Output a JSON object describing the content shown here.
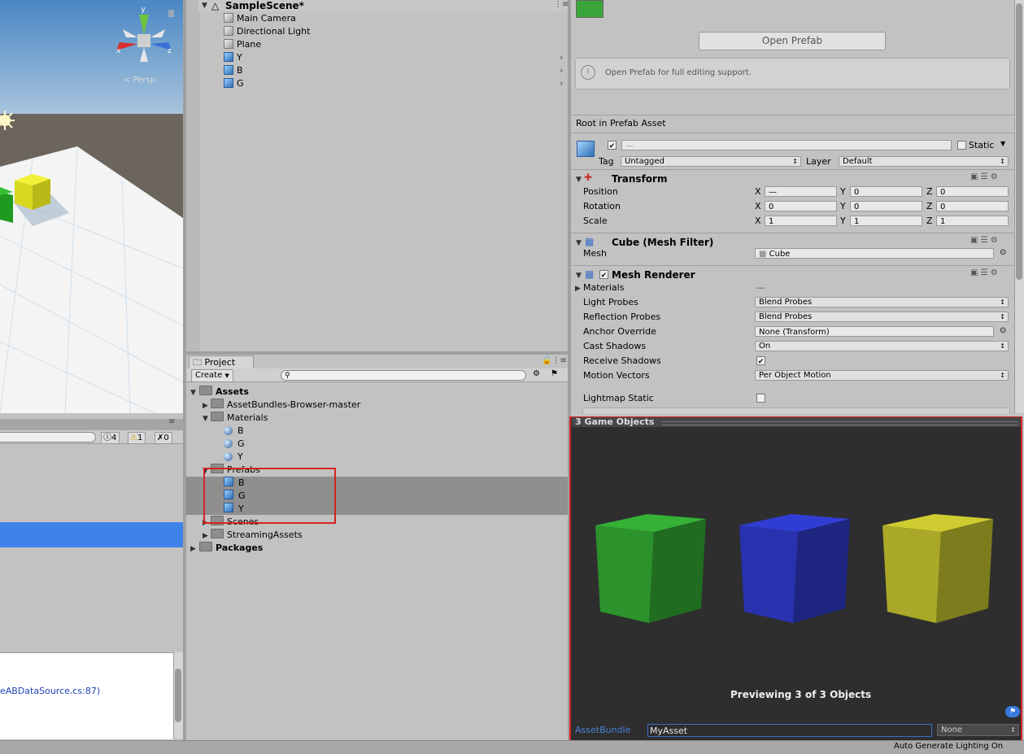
{
  "scene": {
    "persp_label": "< Persp",
    "gizmo_axes": [
      "y",
      "x",
      "z"
    ]
  },
  "console": {
    "error_count": "0",
    "warning_count": "1",
    "info_count": "4",
    "log_link": "eABDataSource.cs:87)"
  },
  "hierarchy": {
    "scene_name": "SampleScene*",
    "items": [
      {
        "label": "Main Camera",
        "icon": "gameobject-icon"
      },
      {
        "label": "Directional Light",
        "icon": "gameobject-icon"
      },
      {
        "label": "Plane",
        "icon": "gameobject-icon"
      },
      {
        "label": "Y",
        "icon": "prefab-icon"
      },
      {
        "label": "B",
        "icon": "prefab-icon"
      },
      {
        "label": "G",
        "icon": "prefab-icon"
      }
    ]
  },
  "project": {
    "tab_label": "Project",
    "create_label": "Create",
    "tree": {
      "assets": "Assets",
      "assetbundles_browser": "AssetBundles-Browser-master",
      "materials": "Materials",
      "materials_items": [
        "B",
        "G",
        "Y"
      ],
      "prefabs": "Prefabs",
      "prefab_items": [
        "B",
        "G",
        "Y"
      ],
      "scenes": "Scenes",
      "streaming_assets": "StreamingAssets",
      "packages": "Packages"
    }
  },
  "inspector": {
    "open_prefab_label": "Open Prefab",
    "help_text": "Open Prefab for full editing support.",
    "root_label": "Root in Prefab Asset",
    "static_label": "Static",
    "tag_label": "Tag",
    "tag_value": "Untagged",
    "layer_label": "Layer",
    "layer_value": "Default",
    "name_value": "—",
    "transform": {
      "title": "Transform",
      "position_label": "Position",
      "rotation_label": "Rotation",
      "scale_label": "Scale",
      "position": {
        "x": "—",
        "y": "0",
        "z": "0"
      },
      "rotation": {
        "x": "0",
        "y": "0",
        "z": "0"
      },
      "scale": {
        "x": "1",
        "y": "1",
        "z": "1"
      }
    },
    "mesh_filter": {
      "title": "Cube (Mesh Filter)",
      "mesh_label": "Mesh",
      "mesh_value": "Cube"
    },
    "mesh_renderer": {
      "title": "Mesh Renderer",
      "materials_label": "Materials",
      "materials_value": "—",
      "light_probes_label": "Light Probes",
      "light_probes_value": "Blend Probes",
      "reflection_probes_label": "Reflection Probes",
      "reflection_probes_value": "Blend Probes",
      "anchor_override_label": "Anchor Override",
      "anchor_override_value": "None (Transform)",
      "cast_shadows_label": "Cast Shadows",
      "cast_shadows_value": "On",
      "receive_shadows_label": "Receive Shadows",
      "motion_vectors_label": "Motion Vectors",
      "motion_vectors_value": "Per Object Motion",
      "lightmap_static_label": "Lightmap Static"
    },
    "axis_labels": {
      "x": "X",
      "y": "Y",
      "z": "Z"
    }
  },
  "preview": {
    "title": "3 Game Objects",
    "caption": "Previewing 3 of 3 Objects",
    "assetbundle_label": "AssetBundle",
    "assetbundle_value": "MyAsset",
    "variant_value": "None",
    "cube_colors": [
      "#2e9a2e",
      "#2a35b8",
      "#b3b12a"
    ]
  },
  "status": {
    "text": "Auto Generate Lighting On"
  }
}
